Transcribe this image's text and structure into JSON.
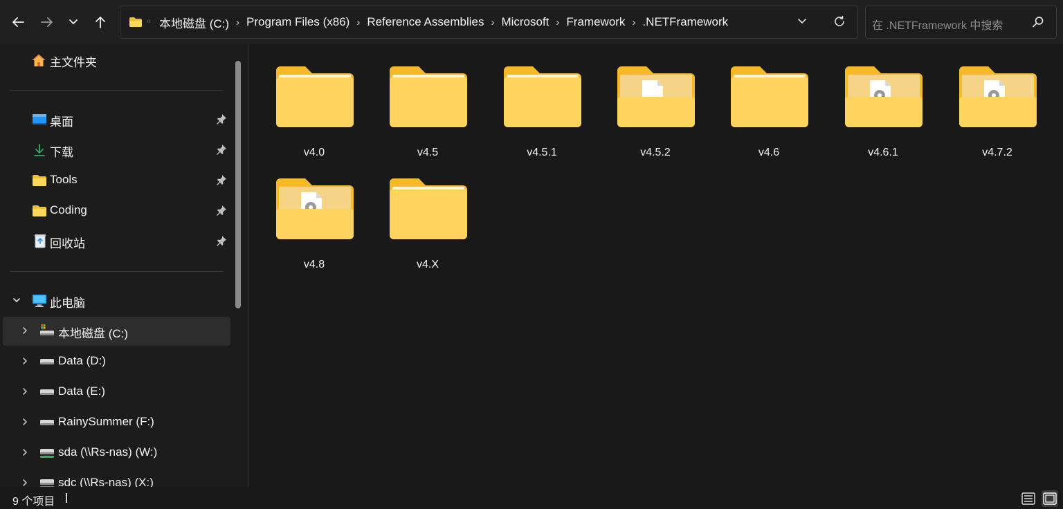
{
  "colors": {
    "background": "#191919",
    "sidebar_bg": "#1c1c1c",
    "selected_bg": "#2d2d2d",
    "folder_yellow": "#ffca28",
    "text": "#f2f2f2"
  },
  "toolbar": {
    "back_icon": "arrow-left-icon",
    "forward_icon": "arrow-right-icon",
    "history_icon": "chevron-down-icon",
    "up_icon": "arrow-up-icon"
  },
  "address": {
    "overflow": "«",
    "breadcrumbs": [
      "本地磁盘 (C:)",
      "Program Files (x86)",
      "Reference Assemblies",
      "Microsoft",
      "Framework",
      ".NETFramework"
    ],
    "separator": "›"
  },
  "search": {
    "placeholder": "在 .NETFramework 中搜索"
  },
  "sidebar": {
    "home": {
      "label": "主文件夹",
      "icon": "home-icon"
    },
    "quick_access": [
      {
        "label": "桌面",
        "icon": "desktop-icon"
      },
      {
        "label": "下载",
        "icon": "download-icon"
      },
      {
        "label": "Tools",
        "icon": "folder-icon"
      },
      {
        "label": "Coding",
        "icon": "folder-icon"
      },
      {
        "label": "回收站",
        "icon": "recycle-bin-icon"
      }
    ],
    "this_pc": {
      "label": "此电脑",
      "icon": "computer-icon"
    },
    "drives": [
      {
        "label": "本地磁盘 (C:)",
        "icon": "system-drive-icon",
        "selected": true
      },
      {
        "label": "Data (D:)",
        "icon": "drive-icon"
      },
      {
        "label": "Data (E:)",
        "icon": "drive-icon"
      },
      {
        "label": "RainySummer (F:)",
        "icon": "drive-icon"
      },
      {
        "label": "sda (\\\\Rs-nas) (W:)",
        "icon": "network-drive-icon"
      },
      {
        "label": "sdc (\\\\Rs-nas) (X:)",
        "icon": "network-drive-icon"
      }
    ]
  },
  "items": [
    {
      "name": "v4.0",
      "type": "plain"
    },
    {
      "name": "v4.5",
      "type": "plain"
    },
    {
      "name": "v4.5.1",
      "type": "plain"
    },
    {
      "name": "v4.5.2",
      "type": "document"
    },
    {
      "name": "v4.6",
      "type": "plain"
    },
    {
      "name": "v4.6.1",
      "type": "settings"
    },
    {
      "name": "v4.7.2",
      "type": "settings"
    },
    {
      "name": "v4.8",
      "type": "settings"
    },
    {
      "name": "v4.X",
      "type": "plain"
    }
  ],
  "status": {
    "item_count": "9 个项目"
  }
}
